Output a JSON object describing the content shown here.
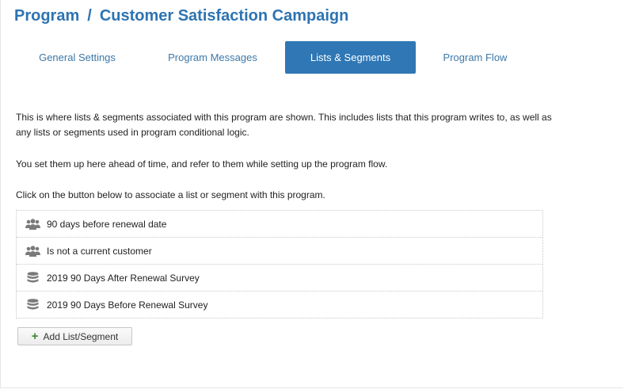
{
  "header": {
    "breadcrumb_root": "Program",
    "separator": "/",
    "page_title": "Customer Satisfaction Campaign"
  },
  "tabs": [
    {
      "label": "General Settings",
      "active": false
    },
    {
      "label": "Program Messages",
      "active": false
    },
    {
      "label": "Lists & Segments",
      "active": true
    },
    {
      "label": "Program Flow",
      "active": false
    }
  ],
  "description": {
    "line1": "This is where lists & segments associated with this program are shown. This includes lists that this program writes to, as well as any lists or segments used in program conditional logic.",
    "line2": "You set them up here ahead of time, and refer to them while setting up the program flow.",
    "line3": "Click on the button below to associate a list or segment with this program."
  },
  "items": [
    {
      "label": "90 days before renewal date",
      "icon": "segment-group-icon"
    },
    {
      "label": "Is not a current customer",
      "icon": "segment-group-icon"
    },
    {
      "label": "2019 90 Days After Renewal Survey",
      "icon": "list-database-icon"
    },
    {
      "label": "2019 90 Days Before Renewal Survey",
      "icon": "list-database-icon"
    }
  ],
  "add_button": {
    "label": "Add List/Segment",
    "icon": "plus-icon"
  },
  "colors": {
    "accent": "#2f77b5",
    "title": "#2d74b2",
    "icon_gray": "#7a7a7a",
    "plus_green": "#3c8a2e"
  }
}
